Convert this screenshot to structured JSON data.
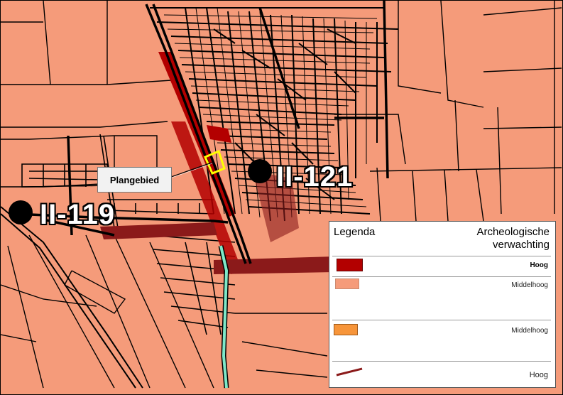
{
  "map": {
    "site_label": "Plangebied",
    "sites": [
      {
        "id": "II-119"
      },
      {
        "id": "II-121"
      }
    ],
    "colors": {
      "background": "#f59b7a",
      "high": "#b30000",
      "medium": "#f59b7a",
      "medium_alt": "#f7953a",
      "line_high": "#8b1a1a",
      "waterway": "#7ee8c8",
      "plan_area": "#ffff00"
    }
  },
  "legend": {
    "title": "Legenda",
    "subtitle_line1": "Archeologische",
    "subtitle_line2": "verwachting",
    "items": [
      {
        "label": "Hoog",
        "kind": "fill",
        "color": "#b30000"
      },
      {
        "label": "Middelhoog",
        "kind": "fill",
        "color": "#f59b7a"
      },
      {
        "label": "Middelhoog",
        "kind": "fill",
        "color": "#f7953a"
      },
      {
        "label": "Hoog",
        "kind": "line",
        "color": "#8b1a1a"
      }
    ]
  }
}
